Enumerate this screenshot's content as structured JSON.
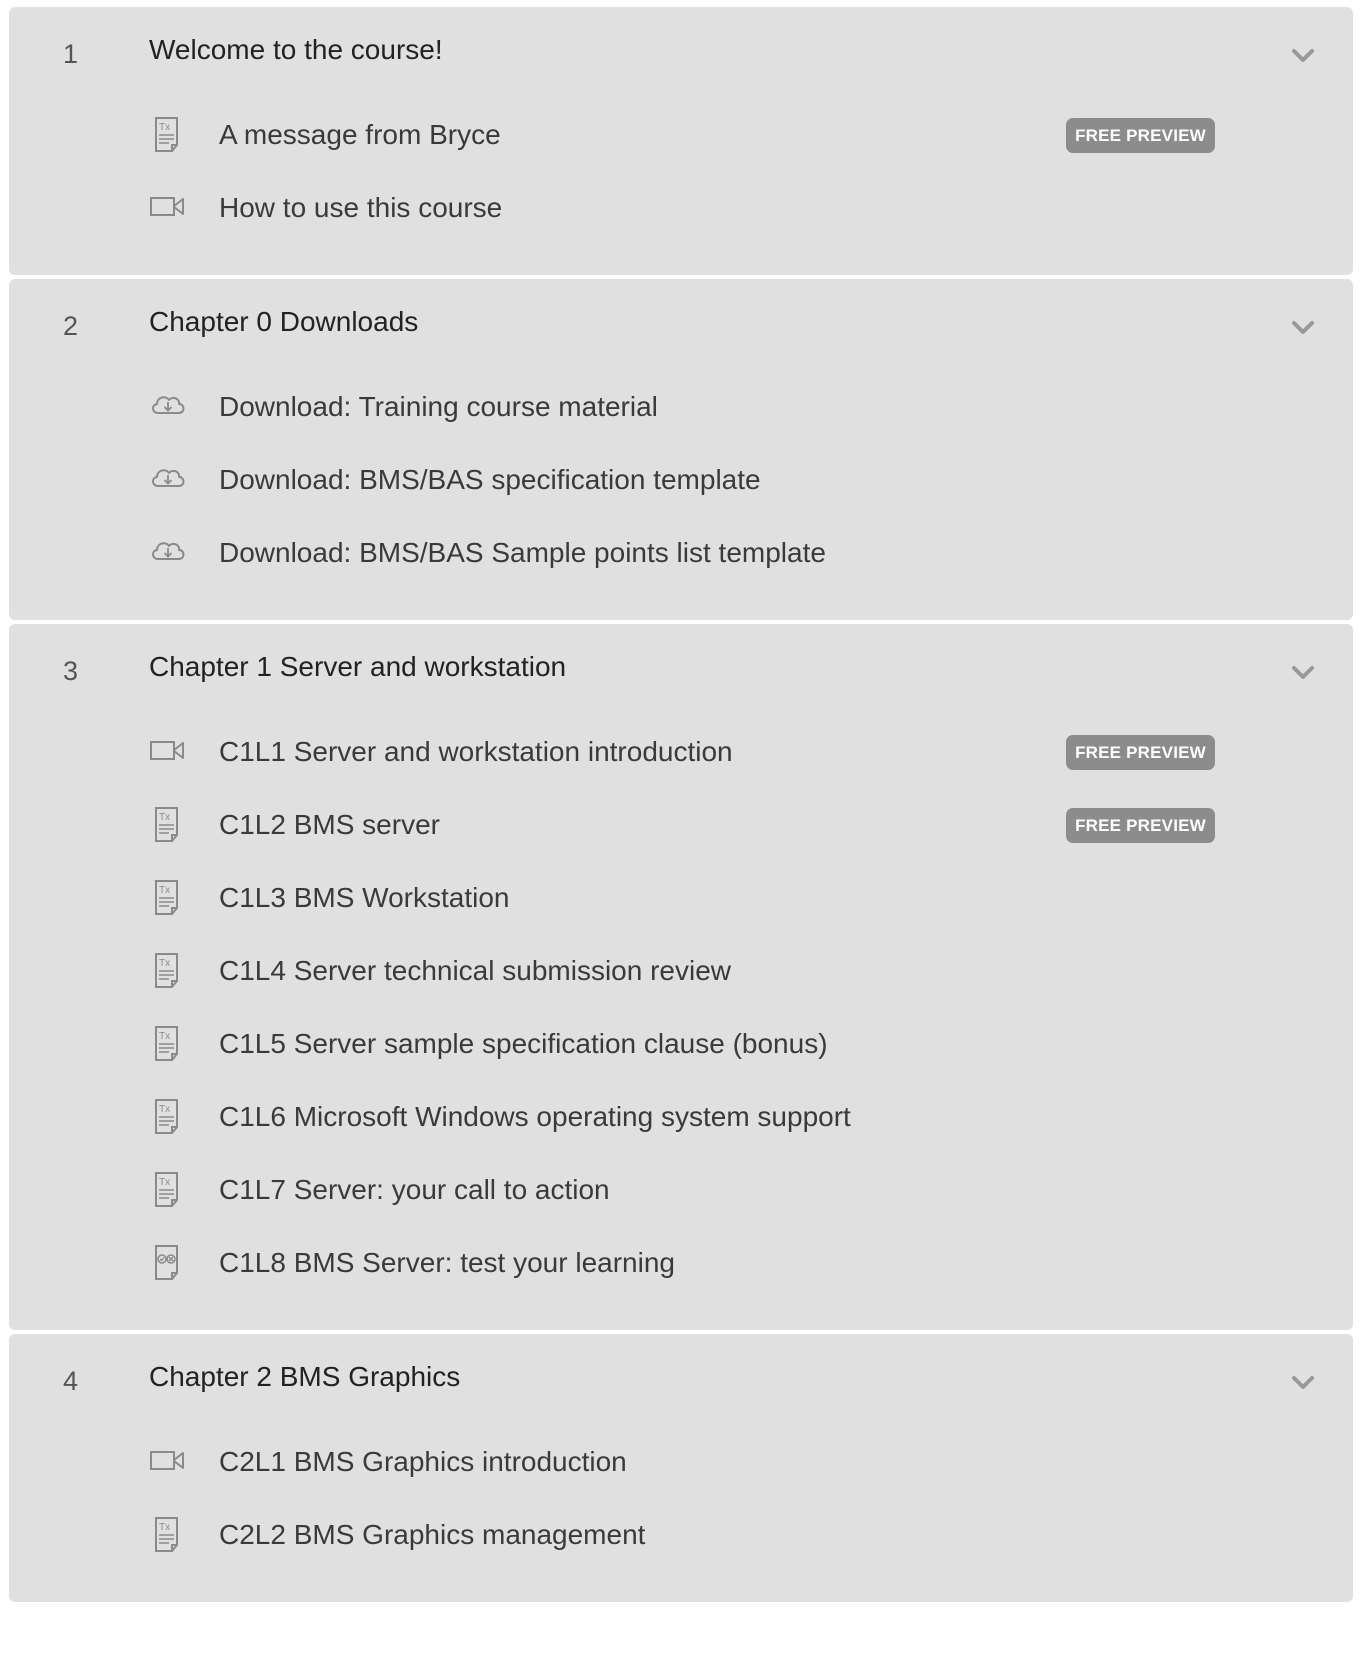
{
  "sections": [
    {
      "number": "1",
      "title": "Welcome to the course!",
      "lessons": [
        {
          "title": "A message from Bryce",
          "icon": "text-document-icon",
          "badge": "FREE PREVIEW"
        },
        {
          "title": "How to use this course",
          "icon": "video-icon",
          "badge": ""
        }
      ]
    },
    {
      "number": "2",
      "title": "Chapter 0 Downloads",
      "lessons": [
        {
          "title": "Download: Training course material",
          "icon": "cloud-download-icon",
          "badge": ""
        },
        {
          "title": "Download: BMS/BAS specification template",
          "icon": "cloud-download-icon",
          "badge": ""
        },
        {
          "title": "Download: BMS/BAS Sample points list template",
          "icon": "cloud-download-icon",
          "badge": ""
        }
      ]
    },
    {
      "number": "3",
      "title": "Chapter 1 Server and workstation",
      "lessons": [
        {
          "title": "C1L1 Server and workstation introduction",
          "icon": "video-icon",
          "badge": "FREE PREVIEW"
        },
        {
          "title": "C1L2 BMS server",
          "icon": "text-document-icon",
          "badge": "FREE PREVIEW"
        },
        {
          "title": "C1L3 BMS Workstation",
          "icon": "text-document-icon",
          "badge": ""
        },
        {
          "title": "C1L4 Server technical submission review",
          "icon": "text-document-icon",
          "badge": ""
        },
        {
          "title": "C1L5 Server sample specification clause (bonus)",
          "icon": "text-document-icon",
          "badge": ""
        },
        {
          "title": "C1L6 Microsoft Windows operating system support",
          "icon": "text-document-icon",
          "badge": ""
        },
        {
          "title": "C1L7 Server: your call to action",
          "icon": "text-document-icon",
          "badge": ""
        },
        {
          "title": "C1L8 BMS Server: test your learning",
          "icon": "quiz-icon",
          "badge": ""
        }
      ]
    },
    {
      "number": "4",
      "title": "Chapter 2 BMS Graphics",
      "lessons": [
        {
          "title": "C2L1 BMS Graphics introduction",
          "icon": "video-icon",
          "badge": ""
        },
        {
          "title": "C2L2 BMS Graphics management",
          "icon": "text-document-icon",
          "badge": ""
        }
      ]
    }
  ],
  "colors": {
    "section_background": "#e0e0e0",
    "badge_background": "#8c8c8c",
    "badge_text": "#ffffff",
    "icon_stroke": "#8a8a8a",
    "chevron": "#999999"
  }
}
